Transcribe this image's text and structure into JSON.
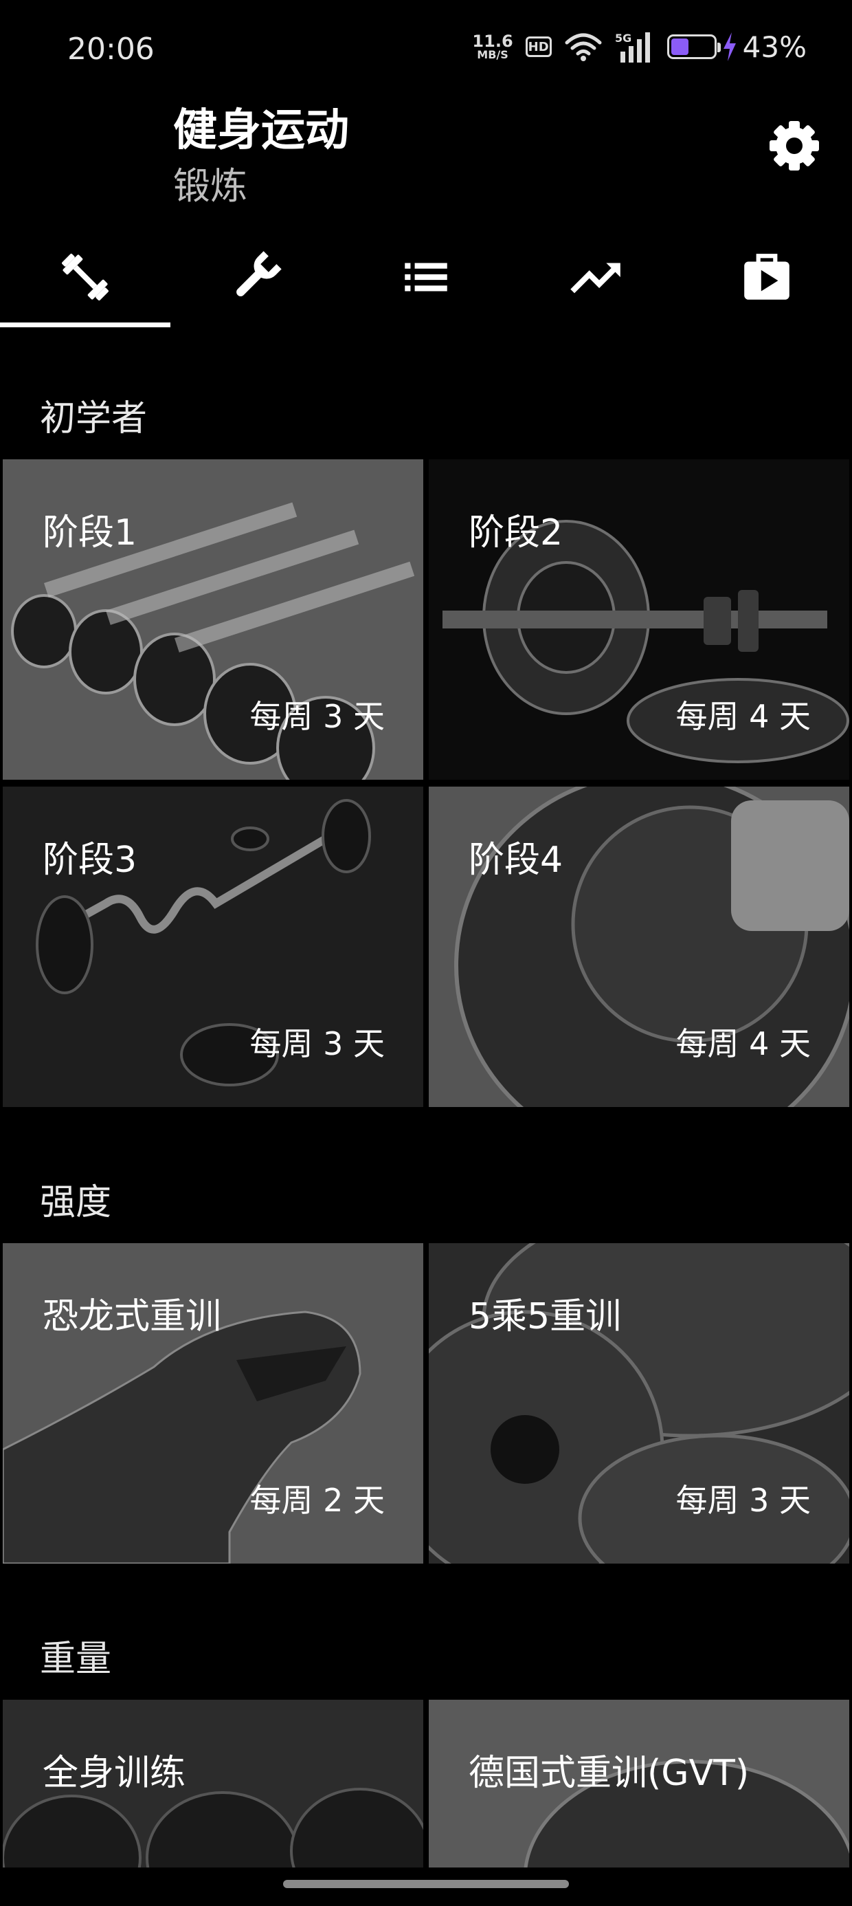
{
  "status": {
    "time": "20:06",
    "net_speed_value": "11.6",
    "net_speed_unit": "MB/S",
    "hd": "HD",
    "network": "5G",
    "battery_percent": "43%",
    "battery_level": 0.43
  },
  "header": {
    "title": "健身运动",
    "subtitle": "锻炼",
    "settings_icon": "gear-icon"
  },
  "tabs": [
    {
      "icon": "dumbbell-icon",
      "active": true
    },
    {
      "icon": "wrench-icon",
      "active": false
    },
    {
      "icon": "list-icon",
      "active": false
    },
    {
      "icon": "trend-icon",
      "active": false
    },
    {
      "icon": "play-bag-icon",
      "active": false
    }
  ],
  "sections": [
    {
      "title": "初学者",
      "cards": [
        {
          "name": "阶段1",
          "freq": "每周 3 天"
        },
        {
          "name": "阶段2",
          "freq": "每周 4 天"
        },
        {
          "name": "阶段3",
          "freq": "每周 3 天"
        },
        {
          "name": "阶段4",
          "freq": "每周 4 天"
        }
      ]
    },
    {
      "title": "强度",
      "cards": [
        {
          "name": "恐龙式重训",
          "freq": "每周 2 天"
        },
        {
          "name": "5乘5重训",
          "freq": "每周 3 天"
        }
      ]
    },
    {
      "title": "重量",
      "cards": [
        {
          "name": "全身训练",
          "freq": ""
        },
        {
          "name": "德国式重训(GVT)",
          "freq": ""
        }
      ]
    }
  ],
  "colors": {
    "accent": "#ffffff",
    "battery": "#8b5cf6",
    "background": "#000000"
  }
}
